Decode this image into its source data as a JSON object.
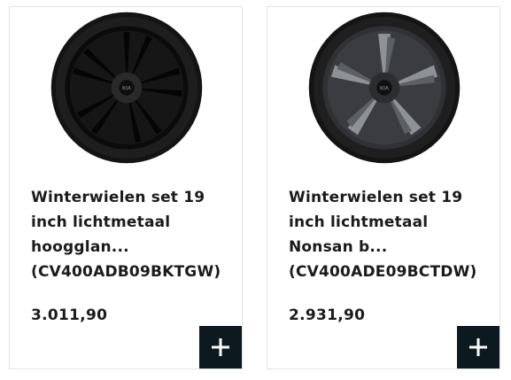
{
  "products": [
    {
      "title": "Winterwielen set 19\ninch lichtmetaal\nhoogglan...\n(CV400ADB09BKTGW)",
      "price": "3.011,90",
      "wheel_style": "gloss-black",
      "add_icon": "plus-icon"
    },
    {
      "title": "Winterwielen set 19\ninch lichtmetaal\nNonsan b...\n(CV400ADE09BCTDW)",
      "price": "2.931,90",
      "wheel_style": "bicolor-grey",
      "add_icon": "plus-icon"
    }
  ],
  "colors": {
    "add_button_bg": "#0c1a1f",
    "text": "#1b1b1b",
    "card_border": "#e3e3e3"
  }
}
